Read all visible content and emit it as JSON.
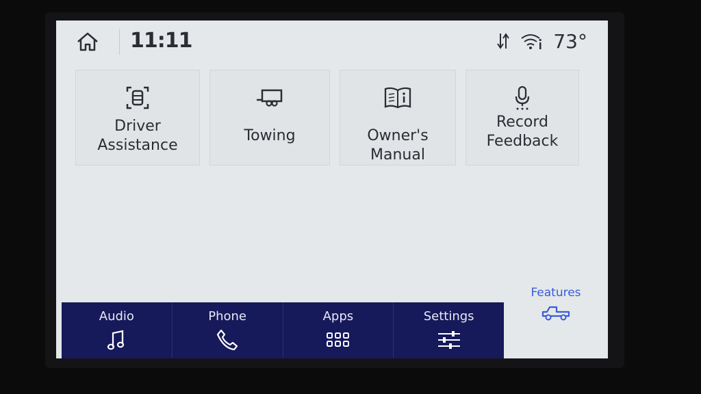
{
  "status": {
    "time": "11:11",
    "temperature": "73°",
    "icons": [
      "home-icon",
      "data-transfer-icon",
      "wifi-info-icon"
    ]
  },
  "tiles": [
    {
      "label": "Driver\nAssistance",
      "icon": "driver-assist-icon"
    },
    {
      "label": "Towing",
      "icon": "trailer-icon"
    },
    {
      "label": "Owner's Manual",
      "icon": "manual-book-icon"
    },
    {
      "label": "Record\nFeedback",
      "icon": "microphone-icon"
    }
  ],
  "nav": {
    "items": [
      {
        "label": "Audio",
        "icon": "music-note-icon"
      },
      {
        "label": "Phone",
        "icon": "phone-icon"
      },
      {
        "label": "Apps",
        "icon": "apps-grid-icon"
      },
      {
        "label": "Settings",
        "icon": "sliders-icon"
      }
    ],
    "active": {
      "label": "Features",
      "icon": "truck-icon"
    }
  },
  "colors": {
    "screen_bg": "#e4e8ea",
    "navbar_bg": "#16195a",
    "active_accent": "#3a5bd6",
    "text": "#2a2e33"
  }
}
